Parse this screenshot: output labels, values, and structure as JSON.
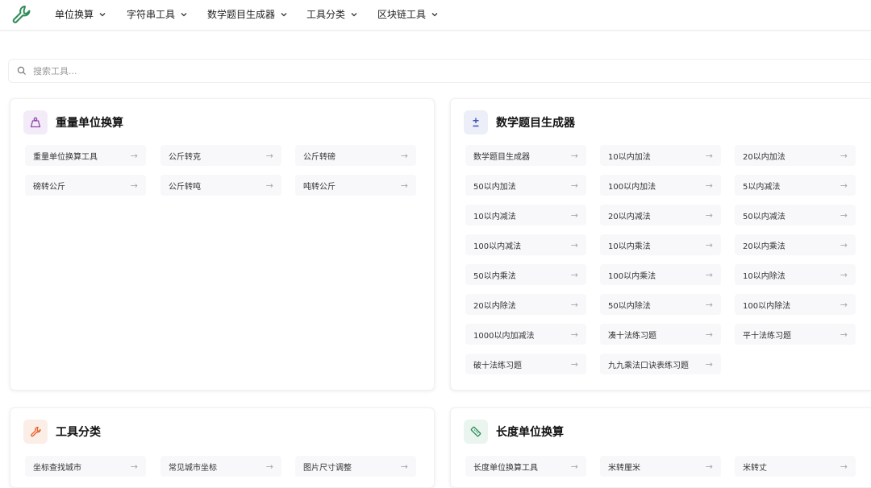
{
  "nav": {
    "items": [
      {
        "label": "单位换算"
      },
      {
        "label": "字符串工具"
      },
      {
        "label": "数学题目生成器"
      },
      {
        "label": "工具分类"
      },
      {
        "label": "区块链工具"
      }
    ]
  },
  "search": {
    "placeholder": "搜索工具..."
  },
  "cards": {
    "weight": {
      "title": "重量单位换算",
      "tools": [
        "重量单位换算工具",
        "公斤转克",
        "公斤转磅",
        "磅转公斤",
        "公斤转吨",
        "吨转公斤"
      ]
    },
    "math": {
      "title": "数学题目生成器",
      "tools": [
        "数学题目生成器",
        "10以内加法",
        "20以内加法",
        "50以内加法",
        "100以内加法",
        "5以内减法",
        "10以内减法",
        "20以内减法",
        "50以内减法",
        "100以内减法",
        "10以内乘法",
        "20以内乘法",
        "50以内乘法",
        "100以内乘法",
        "10以内除法",
        "20以内除法",
        "50以内除法",
        "100以内除法",
        "1000以内加减法",
        "凑十法练习题",
        "平十法练习题",
        "破十法练习题",
        "九九乘法口诀表练习题"
      ]
    },
    "category": {
      "title": "工具分类",
      "tools": [
        "坐标查找城市",
        "常见城市坐标",
        "图片尺寸调整"
      ]
    },
    "length": {
      "title": "长度单位换算",
      "tools": [
        "长度单位换算工具",
        "米转厘米",
        "米转丈"
      ]
    }
  },
  "arrow": "→",
  "colors": {
    "logo": "#2e8b57",
    "weight_icon": "#8e44ad",
    "math_icon": "#3f51b5",
    "category_icon": "#e8602c",
    "length_icon": "#2e8b57"
  }
}
